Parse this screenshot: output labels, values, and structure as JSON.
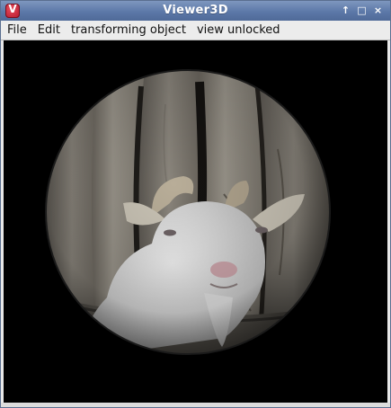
{
  "window": {
    "title": "Viewer3D",
    "app_icon_letter": "V",
    "controls": [
      "↑",
      "□",
      "×"
    ]
  },
  "menu": {
    "items": [
      "File",
      "Edit",
      "transforming object",
      "view unlocked"
    ]
  },
  "scene": {
    "background_color": "#000000",
    "object": "sphere textured with photo of a white goat between wooden planks"
  }
}
